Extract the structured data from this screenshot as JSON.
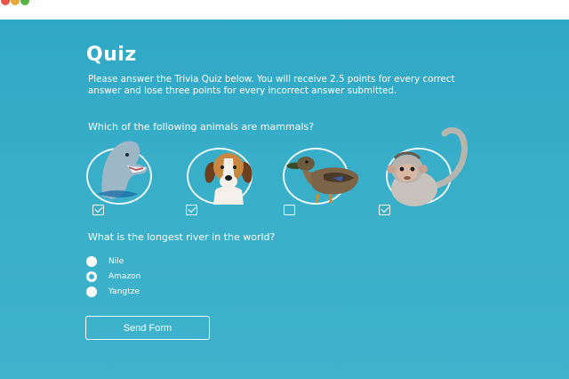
{
  "quiz": {
    "title": "Quiz",
    "intro": "Please answer the Trivia Quiz below. You will receive 2.5 points for every correct answer and lose three points for every incorrect answer submitted.",
    "question1": {
      "text": "Which of the following animals are mammals?",
      "options": [
        {
          "icon": "dolphin",
          "checked": true
        },
        {
          "icon": "beagle-dog",
          "checked": true
        },
        {
          "icon": "duck",
          "checked": false
        },
        {
          "icon": "monkey",
          "checked": true
        }
      ]
    },
    "question2": {
      "text": "What is the longest river in the world?",
      "options": [
        {
          "label": "Nile",
          "selected": false
        },
        {
          "label": "Amazon",
          "selected": true
        },
        {
          "label": "Yangtze",
          "selected": false
        }
      ]
    },
    "submit_label": "Send Form"
  },
  "colors": {
    "background_top": "#2fa8c6",
    "background_bottom": "#3fb3cc",
    "text": "#ffffff"
  }
}
